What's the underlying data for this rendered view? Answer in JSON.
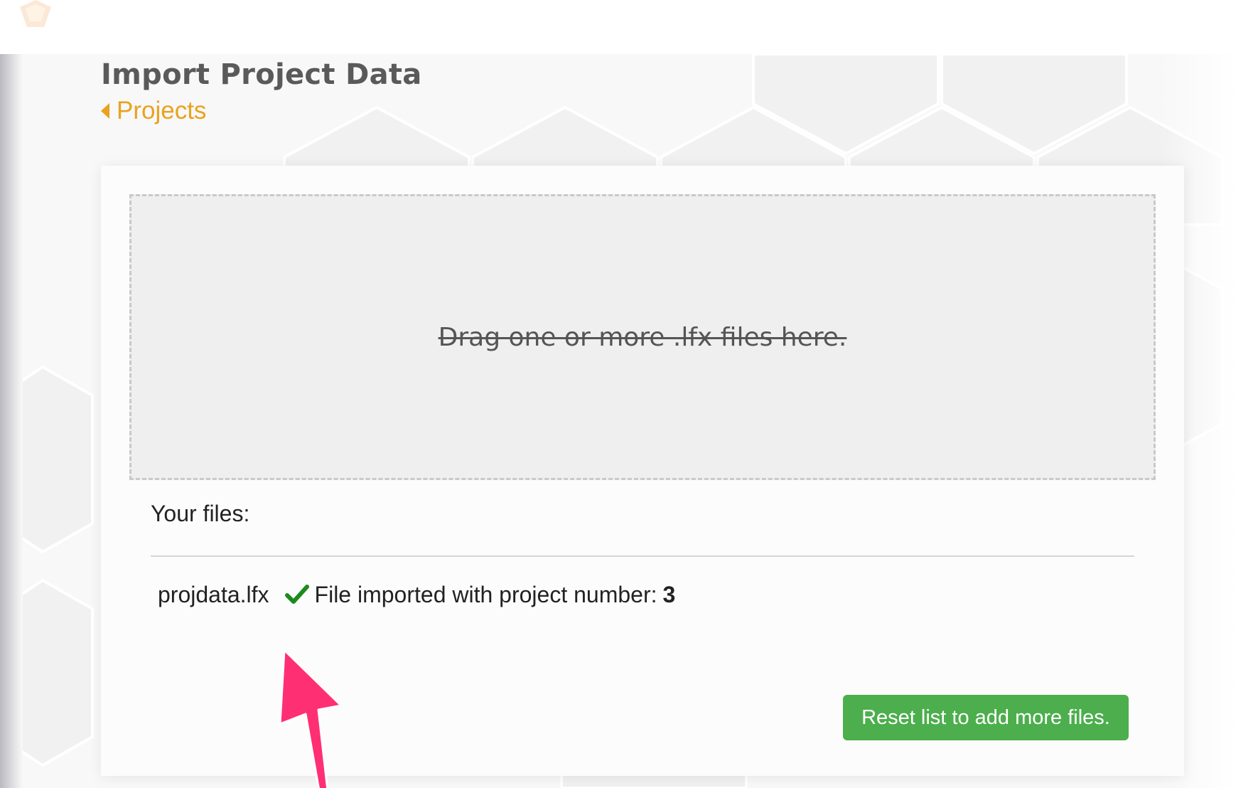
{
  "page": {
    "title": "Import Project Data",
    "back_link_label": "Projects"
  },
  "dropzone": {
    "text": "Drag one or more .lfx files here."
  },
  "files": {
    "label": "Your files:",
    "items": [
      {
        "name": "projdata.lfx",
        "status_icon": "check-icon",
        "status_text": "File imported with project number:",
        "project_number": "3"
      }
    ]
  },
  "actions": {
    "reset_label": "Reset list to add more files."
  },
  "colors": {
    "accent_orange": "#eaa21f",
    "success_green": "#4cae4c",
    "check_green": "#1e8a1e",
    "annotation_pink": "#ff2f74"
  }
}
